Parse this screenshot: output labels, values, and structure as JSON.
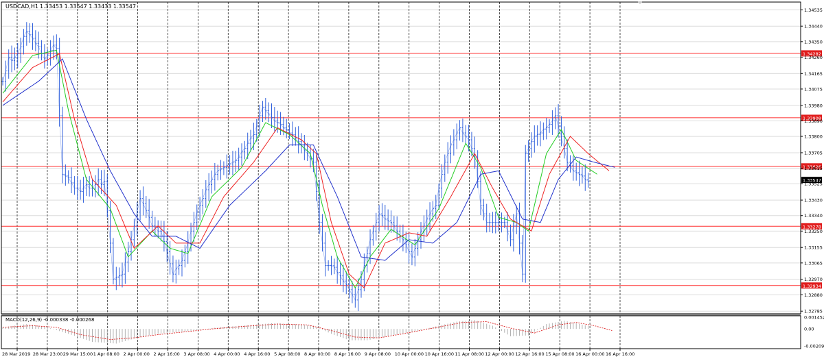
{
  "header": {
    "symbol_label": "USDCAD,H1",
    "ohlc_text": "1.33453 1.33547 1.33433 1.33547"
  },
  "macd_label": "MACD(12,26,9) -0.000338 -0.000268",
  "colors": {
    "price": "#3060dc",
    "ma_fast": "#22cc22",
    "ma_mid": "#ee2222",
    "ma_slow": "#2233cc",
    "level_line": "#ff2b2b",
    "level_tag": "#e11d1d",
    "current_tag": "#000000",
    "grid": "#222222",
    "macd_hist": "#b0b0b0",
    "macd_signal": "#dd2222"
  },
  "chart_data": [
    {
      "type": "line",
      "title": "USDCAD,H1",
      "subtitle": "1.33453 1.33547 1.33433 1.33547",
      "ylim": [
        1.3277,
        1.3458
      ],
      "y_ticks": [
        "1.34535",
        "1.34440",
        "1.34350",
        "1.34260",
        "1.34165",
        "1.34075",
        "1.33980",
        "1.33890",
        "1.33800",
        "1.33705",
        "1.33615",
        "1.33525",
        "1.33430",
        "1.33340",
        "1.33250",
        "1.33155",
        "1.33065",
        "1.32970",
        "1.32880",
        "1.32785"
      ],
      "x_ticks": [
        "28 Mar 2019",
        "28 Mar 23:00",
        "29 Mar 15:00",
        "1 Apr 08:00",
        "2 Apr 00:00",
        "2 Apr 16:00",
        "3 Apr 08:00",
        "4 Apr 00:00",
        "4 Apr 16:00",
        "5 Apr 08:00",
        "8 Apr 00:00",
        "8 Apr 16:00",
        "9 Apr 08:00",
        "10 Apr 00:00",
        "10 Apr 16:00",
        "11 Apr 08:00",
        "12 Apr 00:00",
        "12 Apr 16:00",
        "15 Apr 08:00",
        "16 Apr 00:00",
        "16 Apr 16:00"
      ],
      "grid": true,
      "price_series": {
        "name": "USDCAD",
        "anchors": [
          [
            0,
            1.3415
          ],
          [
            4,
            1.3435
          ],
          [
            8,
            1.344
          ],
          [
            12,
            1.3432
          ],
          [
            15,
            1.3425
          ],
          [
            17,
            1.3432
          ],
          [
            19,
            1.343
          ],
          [
            20,
            1.336
          ],
          [
            22,
            1.3356
          ],
          [
            26,
            1.335
          ],
          [
            30,
            1.335
          ],
          [
            34,
            1.3355
          ],
          [
            37,
            1.3295
          ],
          [
            40,
            1.33
          ],
          [
            43,
            1.332
          ],
          [
            46,
            1.3345
          ],
          [
            50,
            1.333
          ],
          [
            53,
            1.3325
          ],
          [
            57,
            1.33
          ],
          [
            60,
            1.331
          ],
          [
            64,
            1.333
          ],
          [
            68,
            1.335
          ],
          [
            72,
            1.336
          ],
          [
            76,
            1.3363
          ],
          [
            80,
            1.337
          ],
          [
            84,
            1.338
          ],
          [
            87,
            1.3395
          ],
          [
            90,
            1.339
          ],
          [
            95,
            1.3383
          ],
          [
            100,
            1.3375
          ],
          [
            104,
            1.3365
          ],
          [
            106,
            1.333
          ],
          [
            108,
            1.3305
          ],
          [
            110,
            1.3305
          ],
          [
            114,
            1.3296
          ],
          [
            118,
            1.3285
          ],
          [
            120,
            1.3297
          ],
          [
            123,
            1.332
          ],
          [
            126,
            1.3335
          ],
          [
            130,
            1.333
          ],
          [
            134,
            1.332
          ],
          [
            137,
            1.331
          ],
          [
            140,
            1.3325
          ],
          [
            143,
            1.3335
          ],
          [
            145,
            1.334
          ],
          [
            148,
            1.3365
          ],
          [
            150,
            1.3375
          ],
          [
            153,
            1.3385
          ],
          [
            156,
            1.3378
          ],
          [
            158,
            1.3368
          ],
          [
            160,
            1.334
          ],
          [
            162,
            1.333
          ],
          [
            165,
            1.333
          ],
          [
            168,
            1.333
          ],
          [
            170,
            1.332
          ],
          [
            172,
            1.3335
          ],
          [
            174,
            1.33
          ],
          [
            175,
            1.337
          ],
          [
            178,
            1.338
          ],
          [
            182,
            1.3385
          ],
          [
            185,
            1.3392
          ],
          [
            187,
            1.338
          ],
          [
            189,
            1.3365
          ],
          [
            191,
            1.336
          ],
          [
            194,
            1.3356
          ],
          [
            196,
            1.3354
          ]
        ],
        "closes": [
          1.3412,
          1.3418,
          1.3426,
          1.3424,
          1.3426,
          1.3428,
          1.3432,
          1.3438,
          1.3441,
          1.3439,
          1.3437,
          1.3434,
          1.3432,
          1.3428,
          1.3425,
          1.3427,
          1.343,
          1.3433,
          1.3431,
          1.3392,
          1.3358,
          1.3357,
          1.3356,
          1.3353,
          1.335,
          1.335,
          1.3348,
          1.335,
          1.3352,
          1.335,
          1.335,
          1.3352,
          1.3355,
          1.3352,
          1.3354,
          1.3337,
          1.3318,
          1.3297,
          1.3298,
          1.3299,
          1.33,
          1.3307,
          1.3313,
          1.332,
          1.3328,
          1.3336,
          1.3344,
          1.3341,
          1.3337,
          1.3333,
          1.3328,
          1.3327,
          1.3325,
          1.3325,
          1.3319,
          1.3313,
          1.3306,
          1.33,
          1.3303,
          1.3305,
          1.3308,
          1.3313,
          1.3318,
          1.3325,
          1.333,
          1.3336,
          1.334,
          1.3344,
          1.3349,
          1.3352,
          1.3355,
          1.3358,
          1.336,
          1.3361,
          1.3362,
          1.3363,
          1.3364,
          1.3365,
          1.3366,
          1.3368,
          1.3371,
          1.3373,
          1.3376,
          1.3379,
          1.3381,
          1.3386,
          1.3392,
          1.3397,
          1.3395,
          1.3393,
          1.3391,
          1.3389,
          1.3388,
          1.3387,
          1.3385,
          1.3384,
          1.3382,
          1.3381,
          1.3379,
          1.3377,
          1.3375,
          1.3372,
          1.337,
          1.3367,
          1.3365,
          1.3348,
          1.333,
          1.3318,
          1.3305,
          1.3305,
          1.3305,
          1.3304,
          1.3301,
          1.3299,
          1.3296,
          1.3294,
          1.3291,
          1.3288,
          1.3285,
          1.3291,
          1.3297,
          1.3305,
          1.3312,
          1.332,
          1.3325,
          1.333,
          1.3335,
          1.3334,
          1.3332,
          1.3331,
          1.333,
          1.3328,
          1.3325,
          1.3322,
          1.332,
          1.3317,
          1.3313,
          1.331,
          1.3315,
          1.332,
          1.3325,
          1.3328,
          1.3332,
          1.3335,
          1.3338,
          1.334,
          1.335,
          1.3358,
          1.3365,
          1.337,
          1.3375,
          1.3378,
          1.3382,
          1.3385,
          1.3382,
          1.338,
          1.3378,
          1.3373,
          1.3368,
          1.3354,
          1.334,
          1.3335,
          1.333,
          1.333,
          1.333,
          1.333,
          1.333,
          1.333,
          1.333,
          1.3325,
          1.332,
          1.3328,
          1.3335,
          1.3318,
          1.33,
          1.337,
          1.3373,
          1.3377,
          1.338,
          1.3381,
          1.3382,
          1.3384,
          1.3385,
          1.3387,
          1.3389,
          1.3392,
          1.3386,
          1.338,
          1.3373,
          1.3365,
          1.3363,
          1.336,
          1.3359,
          1.3358,
          1.3357,
          1.3355,
          1.3354
        ]
      },
      "ma_series": [
        {
          "name": "",
          "color_key": "ma_fast",
          "anchors": [
            [
              0,
              1.3405
            ],
            [
              10,
              1.3427
            ],
            [
              18,
              1.343
            ],
            [
              22,
              1.3395
            ],
            [
              28,
              1.3355
            ],
            [
              36,
              1.3338
            ],
            [
              42,
              1.331
            ],
            [
              50,
              1.3325
            ],
            [
              56,
              1.3315
            ],
            [
              62,
              1.3312
            ],
            [
              70,
              1.3345
            ],
            [
              80,
              1.3362
            ],
            [
              88,
              1.3388
            ],
            [
              96,
              1.3381
            ],
            [
              103,
              1.337
            ],
            [
              107,
              1.334
            ],
            [
              112,
              1.331
            ],
            [
              118,
              1.3292
            ],
            [
              123,
              1.331
            ],
            [
              130,
              1.3326
            ],
            [
              138,
              1.3317
            ],
            [
              146,
              1.3338
            ],
            [
              155,
              1.3376
            ],
            [
              160,
              1.3362
            ],
            [
              166,
              1.3333
            ],
            [
              172,
              1.333
            ],
            [
              176,
              1.3325
            ],
            [
              182,
              1.337
            ],
            [
              187,
              1.3384
            ],
            [
              192,
              1.3366
            ],
            [
              199,
              1.3358
            ]
          ]
        },
        {
          "name": "",
          "color_key": "ma_mid",
          "anchors": [
            [
              0,
              1.34
            ],
            [
              10,
              1.342
            ],
            [
              19,
              1.3428
            ],
            [
              24,
              1.339
            ],
            [
              30,
              1.3355
            ],
            [
              38,
              1.334
            ],
            [
              44,
              1.3315
            ],
            [
              52,
              1.3328
            ],
            [
              58,
              1.3318
            ],
            [
              66,
              1.3318
            ],
            [
              74,
              1.3345
            ],
            [
              84,
              1.3365
            ],
            [
              92,
              1.3385
            ],
            [
              100,
              1.3378
            ],
            [
              105,
              1.337
            ],
            [
              110,
              1.333
            ],
            [
              116,
              1.33
            ],
            [
              121,
              1.3292
            ],
            [
              128,
              1.3318
            ],
            [
              136,
              1.3324
            ],
            [
              142,
              1.3322
            ],
            [
              150,
              1.3345
            ],
            [
              158,
              1.337
            ],
            [
              164,
              1.335
            ],
            [
              170,
              1.3332
            ],
            [
              177,
              1.3325
            ],
            [
              183,
              1.3358
            ],
            [
              190,
              1.338
            ],
            [
              196,
              1.337
            ],
            [
              203,
              1.336
            ]
          ]
        },
        {
          "name": "",
          "color_key": "ma_slow",
          "anchors": [
            [
              0,
              1.3398
            ],
            [
              12,
              1.3412
            ],
            [
              20,
              1.3425
            ],
            [
              28,
              1.339
            ],
            [
              36,
              1.336
            ],
            [
              44,
              1.3335
            ],
            [
              50,
              1.3322
            ],
            [
              58,
              1.3322
            ],
            [
              66,
              1.3315
            ],
            [
              76,
              1.334
            ],
            [
              88,
              1.336
            ],
            [
              96,
              1.3375
            ],
            [
              104,
              1.3375
            ],
            [
              112,
              1.3345
            ],
            [
              120,
              1.331
            ],
            [
              128,
              1.3308
            ],
            [
              136,
              1.332
            ],
            [
              144,
              1.3318
            ],
            [
              152,
              1.333
            ],
            [
              160,
              1.3358
            ],
            [
              166,
              1.336
            ],
            [
              174,
              1.3332
            ],
            [
              180,
              1.333
            ],
            [
              186,
              1.3355
            ],
            [
              192,
              1.3368
            ],
            [
              198,
              1.3365
            ],
            [
              205,
              1.3362
            ]
          ]
        }
      ],
      "levels": [
        {
          "value": 1.34282,
          "label": "1.34282"
        },
        {
          "value": 1.33908,
          "label": "1.33908"
        },
        {
          "value": 1.33626,
          "label": "1.33626"
        },
        {
          "value": 1.33278,
          "label": "1.33278"
        },
        {
          "value": 1.32934,
          "label": "1.32934"
        }
      ],
      "current": {
        "value": 1.33547,
        "label": "1.33547"
      }
    },
    {
      "type": "bar",
      "title": "MACD(12,26,9) -0.000338 -0.000268",
      "ylim": [
        -0.002097,
        0.001452
      ],
      "y_ticks": [
        "0.001452",
        "0.00",
        "-0.002097"
      ],
      "histogram_anchors": [
        [
          0,
          0.0002
        ],
        [
          8,
          0.0006
        ],
        [
          14,
          0.0003
        ],
        [
          22,
          -0.0006
        ],
        [
          30,
          -0.0016
        ],
        [
          38,
          -0.0018
        ],
        [
          46,
          -0.001
        ],
        [
          52,
          -0.0006
        ],
        [
          58,
          -0.0004
        ],
        [
          64,
          -0.0002
        ],
        [
          72,
          0.0002
        ],
        [
          80,
          0.0004
        ],
        [
          90,
          0.0007
        ],
        [
          98,
          0.0006
        ],
        [
          104,
          0.0004
        ],
        [
          110,
          -0.0006
        ],
        [
          116,
          -0.0014
        ],
        [
          122,
          -0.0014
        ],
        [
          130,
          -0.0008
        ],
        [
          138,
          -0.0003
        ],
        [
          146,
          0.0004
        ],
        [
          152,
          0.0009
        ],
        [
          158,
          0.0011
        ],
        [
          164,
          0.0004
        ],
        [
          170,
          -0.0009
        ],
        [
          176,
          -0.0008
        ],
        [
          182,
          0.0006
        ],
        [
          188,
          0.001
        ],
        [
          192,
          0.0007
        ],
        [
          198,
          0.0002
        ]
      ],
      "signal_anchors": [
        [
          0,
          0.0002
        ],
        [
          10,
          0.0004
        ],
        [
          18,
          0.0002
        ],
        [
          26,
          -0.0007
        ],
        [
          36,
          -0.0013
        ],
        [
          44,
          -0.0011
        ],
        [
          52,
          -0.0007
        ],
        [
          60,
          -0.0004
        ],
        [
          70,
          0.0
        ],
        [
          80,
          0.0003
        ],
        [
          92,
          0.0006
        ],
        [
          102,
          0.0005
        ],
        [
          110,
          -0.0002
        ],
        [
          118,
          -0.001
        ],
        [
          126,
          -0.0011
        ],
        [
          134,
          -0.0006
        ],
        [
          144,
          0.0001
        ],
        [
          154,
          0.0008
        ],
        [
          162,
          0.0009
        ],
        [
          170,
          0.0001
        ],
        [
          178,
          -0.0005
        ],
        [
          186,
          0.0005
        ],
        [
          192,
          0.0008
        ],
        [
          198,
          0.0004
        ],
        [
          204,
          -0.0002
        ]
      ]
    }
  ]
}
